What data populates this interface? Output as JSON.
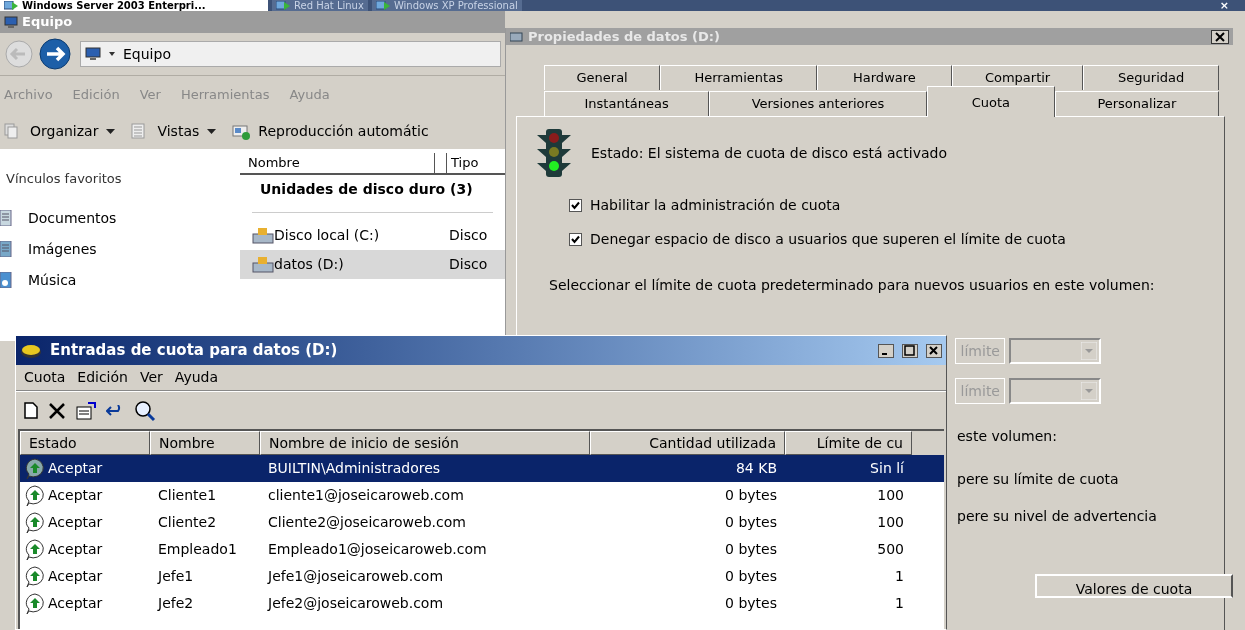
{
  "vm_tabs": [
    {
      "label": "Windows Server 2003 Enterpri...",
      "selected": true
    },
    {
      "label": "Red Hat Linux",
      "selected": false
    },
    {
      "label": "Windows XP Professional",
      "selected": false
    }
  ],
  "vm_close": "×",
  "explorer": {
    "title": "Equipo",
    "address": "Equipo",
    "menu": [
      "Archivo",
      "Edición",
      "Ver",
      "Herramientas",
      "Ayuda"
    ],
    "toolbar": [
      {
        "label": "Organizar",
        "kind": "organize"
      },
      {
        "label": "Vistas",
        "kind": "views"
      },
      {
        "label": "Reproducción automátic",
        "kind": "autoplay"
      }
    ],
    "favorites_title": "Vínculos favoritos",
    "favorites": [
      {
        "label": "Documentos",
        "kind": "docs"
      },
      {
        "label": "Imágenes",
        "kind": "pics"
      },
      {
        "label": "Música",
        "kind": "music"
      }
    ],
    "columns": [
      "Nombre",
      "Tipo"
    ],
    "group": "Unidades de disco duro (3)",
    "drives": [
      {
        "name": "Disco local (C:)",
        "type": "Disco",
        "selected": false
      },
      {
        "name": "datos (D:)",
        "type": "Disco",
        "selected": true
      }
    ]
  },
  "properties": {
    "title": "Propiedades de datos (D:)",
    "tab_rows": [
      [
        {
          "label": "General",
          "selected": false
        },
        {
          "label": "Herramientas",
          "selected": false
        },
        {
          "label": "Hardware",
          "selected": false
        },
        {
          "label": "Compartir",
          "selected": false
        },
        {
          "label": "Seguridad",
          "selected": false
        }
      ],
      [
        {
          "label": "Instantáneas",
          "selected": false
        },
        {
          "label": "Versiones anteriores",
          "selected": false
        },
        {
          "label": "Cuota",
          "selected": true
        },
        {
          "label": "Personalizar",
          "selected": false
        }
      ]
    ],
    "status": "Estado:  El sistema de cuota de disco está activado",
    "checkboxes": [
      {
        "label": "Habilitar la administración de cuota",
        "checked": true
      },
      {
        "label": "Denegar espacio de disco a usuarios que superen el límite de cuota",
        "checked": true
      }
    ],
    "default_limit_text": "Seleccionar el límite de cuota predeterminado para nuevos usuarios en este volumen:",
    "limit_labels": [
      "límite",
      "límite"
    ],
    "log_text": "este volumen:",
    "log_options": [
      "pere su límite de cuota",
      "pere su nivel de advertencia"
    ],
    "values_button": "Valores de cuota"
  },
  "quota": {
    "title": "Entradas de cuota para datos (D:)",
    "menu": [
      "Cuota",
      "Edición",
      "Ver",
      "Ayuda"
    ],
    "columns": [
      "Estado",
      "Nombre",
      "Nombre de inicio de sesión",
      "Cantidad utilizada",
      "Límite de cu"
    ],
    "rows": [
      {
        "status": "Aceptar",
        "name": "",
        "login": "BUILTIN\\Administradores",
        "used": "84 KB",
        "limit": "Sin lí",
        "selected": true
      },
      {
        "status": "Aceptar",
        "name": "Cliente1",
        "login": "cliente1@joseicaroweb.com",
        "used": "0 bytes",
        "limit": "100",
        "selected": false
      },
      {
        "status": "Aceptar",
        "name": "Cliente2",
        "login": "Cliente2@joseicaroweb.com",
        "used": "0 bytes",
        "limit": "100",
        "selected": false
      },
      {
        "status": "Aceptar",
        "name": "Empleado1",
        "login": "Empleado1@joseicaroweb.com",
        "used": "0 bytes",
        "limit": "500",
        "selected": false
      },
      {
        "status": "Aceptar",
        "name": "Jefe1",
        "login": "Jefe1@joseicaroweb.com",
        "used": "0 bytes",
        "limit": "1",
        "selected": false
      },
      {
        "status": "Aceptar",
        "name": "Jefe2",
        "login": "Jefe2@joseicaroweb.com",
        "used": "0 bytes",
        "limit": "1",
        "selected": false
      }
    ]
  }
}
